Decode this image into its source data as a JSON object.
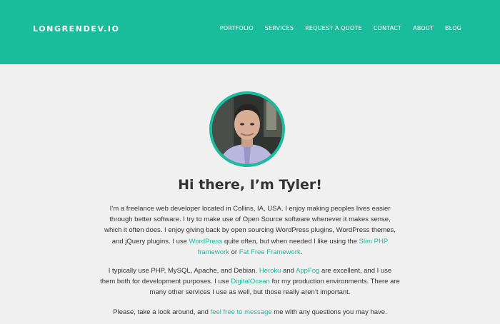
{
  "header": {
    "brand": "LONGRENDEV.IO",
    "nav": [
      "PORTFOLIO",
      "SERVICES",
      "REQUEST A QUOTE",
      "CONTACT",
      "ABOUT",
      "BLOG"
    ]
  },
  "colors": {
    "accent": "#1bbc9b",
    "background": "#f0f0f0",
    "text": "#333333"
  },
  "avatar": {
    "icon": "profile-photo"
  },
  "headline": "Hi there, I’m Tyler!",
  "intro": {
    "t1": "I’m a freelance web developer located in Collins, IA, USA. I enjoy making peoples lives easier through better software. I try to make use of Open Source software whenever it makes sense, which it often does. I enjoy giving back by open sourcing WordPress plugins, WordPress themes, and jQuery plugins. I use ",
    "link_wordpress": "WordPress",
    "t2": " quite often, but when needed I like using the ",
    "link_slim": "Slim PHP framework",
    "t3": " or ",
    "link_fat": "Fat Free Framework",
    "t4": "."
  },
  "stack": {
    "t1": "I typically use PHP, MySQL, Apache, and Debian. ",
    "link_heroku": "Heroku",
    "t2": " and ",
    "link_appfog": "AppFog",
    "t3": " are excellent, and I use them both for development purposes. I use ",
    "link_do": "DigitalOcean",
    "t4": " for my production environments. There are many other services I use as well, but those really aren’t important."
  },
  "closing": {
    "t1": "Please, take a look around, and ",
    "link_message": "feel free to message",
    "t2": " me with any questions you may have."
  }
}
